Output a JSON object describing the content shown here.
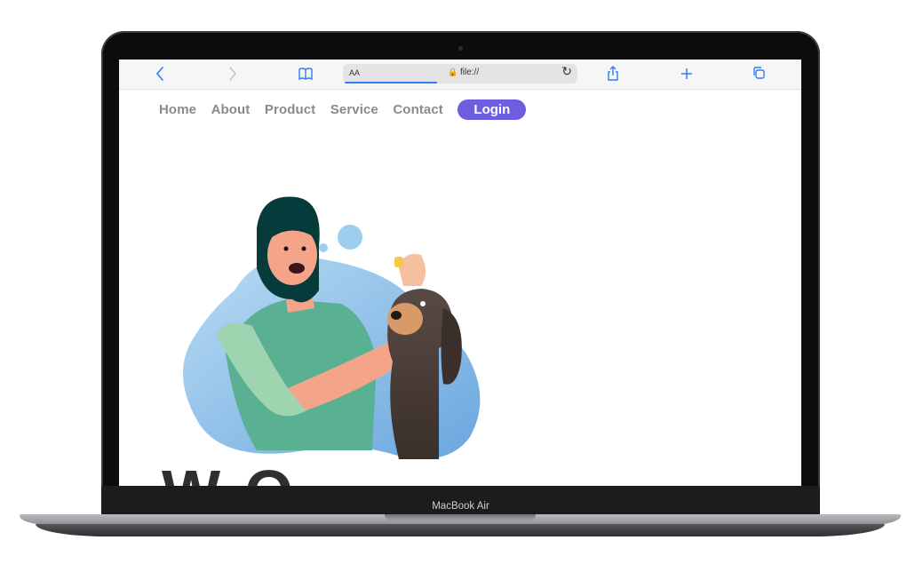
{
  "device": {
    "label": "MacBook Air"
  },
  "browser": {
    "back_icon": "chevron-left-icon",
    "forward_icon": "chevron-right-icon",
    "bookmarks_icon": "book-icon",
    "reader_label": "AA",
    "url": "file://",
    "share_icon": "share-icon",
    "new_tab_icon": "plus-icon",
    "tabs_icon": "tabs-icon",
    "accent": "#2f7df6"
  },
  "nav": {
    "items": [
      {
        "label": "Home"
      },
      {
        "label": "About"
      },
      {
        "label": "Product"
      },
      {
        "label": "Service"
      },
      {
        "label": "Contact"
      }
    ],
    "login_label": "Login",
    "login_color": "#6d5ddf"
  },
  "hero": {
    "heading_partial": "W  O",
    "illustration": "woman-giving-dog-ear-drops"
  }
}
